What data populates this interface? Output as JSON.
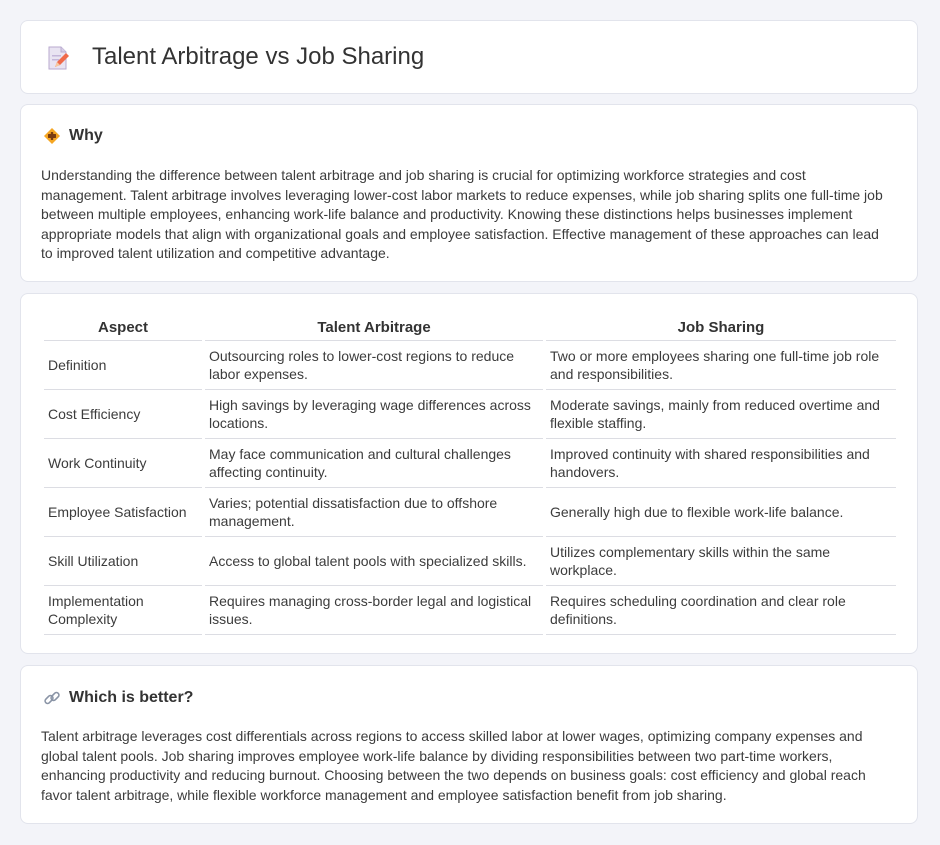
{
  "page": {
    "title": "Talent Arbitrage vs Job Sharing"
  },
  "why": {
    "heading": "Why",
    "icon": "diamond-warning-icon",
    "text": "Understanding the difference between talent arbitrage and job sharing is crucial for optimizing workforce strategies and cost management. Talent arbitrage involves leveraging lower-cost labor markets to reduce expenses, while job sharing splits one full-time job between multiple employees, enhancing work-life balance and productivity. Knowing these distinctions helps businesses implement appropriate models that align with organizational goals and employee satisfaction. Effective management of these approaches can lead to improved talent utilization and competitive advantage."
  },
  "table": {
    "headers": [
      "Aspect",
      "Talent Arbitrage",
      "Job Sharing"
    ],
    "rows": [
      {
        "aspect": "Definition",
        "ta": "Outsourcing roles to lower-cost regions to reduce labor expenses.",
        "js": "Two or more employees sharing one full-time job role and responsibilities."
      },
      {
        "aspect": "Cost Efficiency",
        "ta": "High savings by leveraging wage differences across locations.",
        "js": "Moderate savings, mainly from reduced overtime and flexible staffing."
      },
      {
        "aspect": "Work Continuity",
        "ta": "May face communication and cultural challenges affecting continuity.",
        "js": "Improved continuity with shared responsibilities and handovers."
      },
      {
        "aspect": "Employee Satisfaction",
        "ta": "Varies; potential dissatisfaction due to offshore management.",
        "js": "Generally high due to flexible work-life balance."
      },
      {
        "aspect": "Skill Utilization",
        "ta": "Access to global talent pools with specialized skills.",
        "js": "Utilizes complementary skills within the same workplace."
      },
      {
        "aspect": "Implementation Complexity",
        "ta": "Requires managing cross-border legal and logistical issues.",
        "js": "Requires scheduling coordination and clear role definitions."
      }
    ]
  },
  "better": {
    "heading": "Which is better?",
    "icon": "link-icon",
    "text": "Talent arbitrage leverages cost differentials across regions to access skilled labor at lower wages, optimizing company expenses and global talent pools. Job sharing improves employee work-life balance by dividing responsibilities between two part-time workers, enhancing productivity and reducing burnout. Choosing between the two depends on business goals: cost efficiency and global reach favor talent arbitrage, while flexible workforce management and employee satisfaction benefit from job sharing."
  },
  "colors": {
    "background": "#f3f4f9",
    "card": "#ffffff",
    "icon_accent": "#f0a020"
  }
}
